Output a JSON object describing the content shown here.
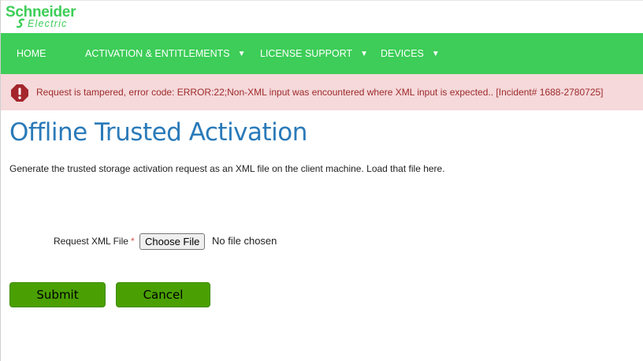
{
  "brand": {
    "name": "Schneider",
    "sub": "Electric",
    "color": "#3dcd58"
  },
  "nav": {
    "items": [
      {
        "label": "HOME",
        "dropdown": false
      },
      {
        "label": "ACTIVATION & ENTITLEMENTS",
        "dropdown": true
      },
      {
        "label": "LICENSE SUPPORT",
        "dropdown": true
      },
      {
        "label": "DEVICES",
        "dropdown": true
      }
    ],
    "caret_icon": "chevron-down-icon",
    "background": "#3dcd58"
  },
  "alert": {
    "icon": "alert-error-icon",
    "message": "Request is tampered, error code: ERROR:22;Non-XML input was encountered where XML input is expected.. [Incident# 1688-2780725]",
    "background": "#f5d9db",
    "text_color": "#9e2a2a"
  },
  "page": {
    "title": "Offline Trusted Activation",
    "description": "Generate the trusted storage activation request as an XML file on the client machine. Load that file here."
  },
  "form": {
    "file_label": "Request XML File",
    "required_mark": "*",
    "choose_label": "Choose File",
    "no_file_text": "No file chosen"
  },
  "actions": {
    "submit_label": "Submit",
    "cancel_label": "Cancel",
    "button_color": "#4aa002"
  }
}
